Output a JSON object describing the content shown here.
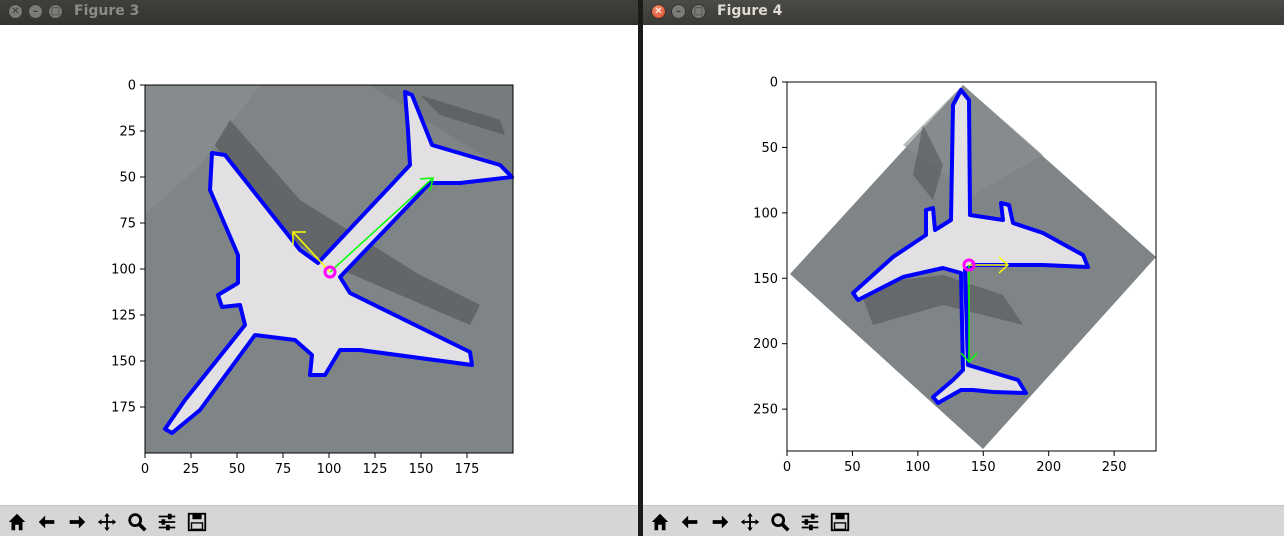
{
  "windows": [
    {
      "title": "Figure 3",
      "active": false,
      "axes": {
        "xlim": [
          0,
          200
        ],
        "ylim": [
          200,
          0
        ],
        "xticks": [
          "0",
          "25",
          "50",
          "75",
          "100",
          "125",
          "150",
          "175"
        ],
        "yticks": [
          "0",
          "25",
          "50",
          "75",
          "100",
          "125",
          "150",
          "175"
        ]
      }
    },
    {
      "title": "Figure 4",
      "active": true,
      "axes": {
        "xlim": [
          0,
          282
        ],
        "ylim": [
          282,
          0
        ],
        "xticks": [
          "0",
          "50",
          "100",
          "150",
          "200",
          "250"
        ],
        "yticks": [
          "0",
          "50",
          "100",
          "150",
          "200",
          "250"
        ]
      }
    }
  ],
  "toolbar_icons": [
    "home-icon",
    "back-arrow-icon",
    "forward-arrow-icon",
    "pan-icon",
    "zoom-icon",
    "configure-subplots-icon",
    "save-icon"
  ],
  "colors": {
    "contour": "#0000ff",
    "major_axis": "#00ff00",
    "minor_axis": "#ffff00",
    "centroid": "#ff00ff"
  }
}
